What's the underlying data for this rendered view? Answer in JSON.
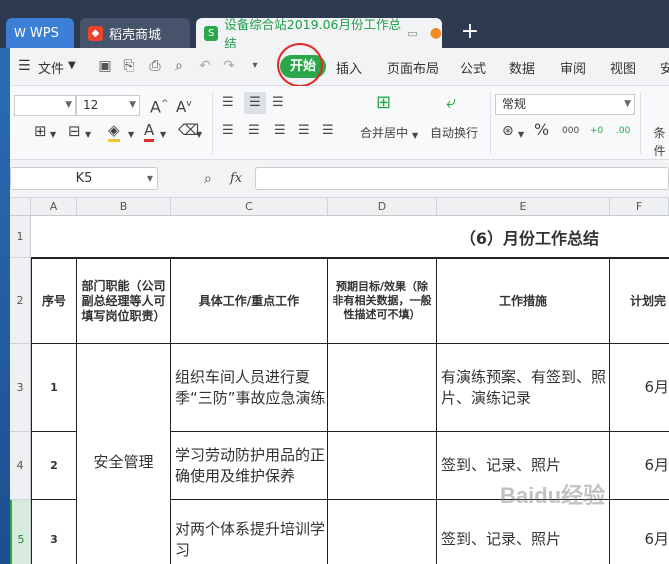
{
  "tabs": {
    "wps": "WPS",
    "shop": "稻壳商城",
    "doc": "设备综合站2019.06月份工作总结"
  },
  "menu": {
    "file": "文件",
    "start": "开始",
    "insert": "插入",
    "layout": "页面布局",
    "formula": "公式",
    "data": "数据",
    "review": "审阅",
    "view": "视图",
    "security": "安"
  },
  "ribbon": {
    "font_size": "12",
    "merge": "合并居中",
    "wrap": "自动换行",
    "number_format": "常规",
    "conditional": "条件",
    "percent": "%",
    "dec_inc": "000",
    "dec_dec": ".00"
  },
  "formula": {
    "cell_ref": "K5",
    "fx": "fx",
    "value": ""
  },
  "columns": [
    "A",
    "B",
    "C",
    "D",
    "E",
    "F"
  ],
  "rows": [
    "1",
    "2",
    "3",
    "4",
    "5"
  ],
  "sheet": {
    "title": "（6）月份工作总结",
    "headers": {
      "seq": "序号",
      "dept": "部门职能（公司副总经理等人可填写岗位职责）",
      "work": "具体工作/重点工作",
      "goal": "预期目标/效果（除非有相关数据，一般性描述可不填）",
      "measure": "工作措施",
      "plan": "计划完"
    },
    "rows": [
      {
        "seq": "1",
        "work": "组织车间人员进行夏季“三防”事故应急演练",
        "measure": "有演练预案、有签到、照片、演练记录",
        "plan": "6月"
      },
      {
        "seq": "2",
        "work": "学习劳动防护用品的正确使用及维护保养",
        "measure": "签到、记录、照片",
        "plan": "6月"
      },
      {
        "seq": "3",
        "work": "对两个体系提升培训学习",
        "measure": "签到、记录、照片",
        "plan": "6月"
      }
    ],
    "dept_value": "安全管理"
  },
  "watermark": "Baidu经验",
  "colors": {
    "accent": "#2aa74a",
    "highlight": "#e02a2a"
  }
}
